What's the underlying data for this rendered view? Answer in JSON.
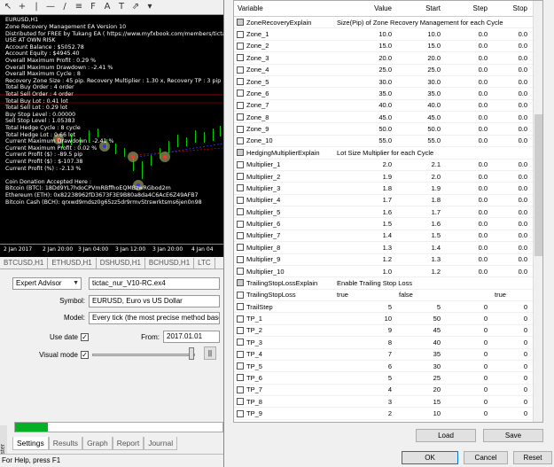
{
  "chart": {
    "window_title": "EURUSD,H1",
    "info_lines": [
      "Zone Recovery Management EA Version 10",
      "Distributed for FREE by Tukang EA ( https://www.myfxbook.com/members/tictac_nur )",
      "USE AT OWN RISK",
      "Account Balance : $5052.78",
      "Account Equity : $4945.40",
      "Overall Maximum Profit : 0.29 %",
      "Overall Maximum Drawdown : -2.41 %",
      "Overall Maximum Cycle : 8",
      "Recovery Zone Size : 45 pip. Recovery Multiplier : 1.30 x, Recovery TP : 3 pip",
      "Total Buy Order : 4 order",
      "Total Sell Order : 4 order",
      "Total Buy Lot : 0.41 lot",
      "Total Sell Lot : 0.29 lot",
      "Buy Stop Level : 0.00000",
      "Sell Stop Level : 1.05383",
      "Total Hedge Cycle : 8 cycle",
      "Total Hedge Lot : 0.66 lot",
      "Current Maximum Drawdown : -2.41 %",
      "Current Maximum Profit : 0.02 %",
      "Current Profit ($) : -89.5 pip",
      "Current Profit ($) : $-107.38",
      "Current Profit (%) : -2.13 %",
      "",
      "Coin Donation Accepted Here :",
      "Bitcoin (BTC): 18Dd9YL7hdoCPVmRBffhoEQMBzwRGbod2m",
      "Ethereum (ETH): 0x82238962fD3673F3E9B80a8da4C6AcE6Z49AFB7",
      "Bitcoin Cash (BCH): qrxwd9mdsz0g65zz5dr9rmvStrswrktsms6jen0n98"
    ],
    "time_ticks": [
      "2 Jan 2017",
      "2 Jan 20:00",
      "3 Jan 04:00",
      "3 Jan 12:00",
      "3 Jan 20:00",
      "4 Jan 04"
    ],
    "symbol_tabs": [
      "BTCUSD,H1",
      "ETHUSD,H1",
      "DSHUSD,H1",
      "BCHUSD,H1",
      "LTC"
    ]
  },
  "tester": {
    "type_value": "Expert Advisor",
    "ea_value": "tictac_nur_V10-RC.ex4",
    "symbol_label": "Symbol:",
    "symbol_value": "EURUSD, Euro vs US Dollar",
    "model_label": "Model:",
    "model_value": "Every tick (the most precise method based on a",
    "use_date_label": "Use date",
    "from_label": "From:",
    "from_value": "2017.01.01",
    "visual_label": "Visual mode",
    "pause_label": "||",
    "progress": 0.16,
    "side_label": "Tester",
    "tabs": [
      "Settings",
      "Results",
      "Graph",
      "Report",
      "Journal"
    ],
    "status": "For Help, press F1"
  },
  "dialog": {
    "headers": [
      "Variable",
      "Value",
      "Start",
      "Step",
      "Stop"
    ],
    "rows": [
      {
        "name": "ZoneRecoveryExplain",
        "wide": "Size(Pip) of Zone Recovery Management for each Cycle",
        "header": true
      },
      {
        "name": "Zone_1",
        "value": "10.0",
        "start": "10.0",
        "step": "0.0",
        "stop": "0.0"
      },
      {
        "name": "Zone_2",
        "value": "15.0",
        "start": "15.0",
        "step": "0.0",
        "stop": "0.0"
      },
      {
        "name": "Zone_3",
        "value": "20.0",
        "start": "20.0",
        "step": "0.0",
        "stop": "0.0"
      },
      {
        "name": "Zone_4",
        "value": "25.0",
        "start": "25.0",
        "step": "0.0",
        "stop": "0.0"
      },
      {
        "name": "Zone_5",
        "value": "30.0",
        "start": "30.0",
        "step": "0.0",
        "stop": "0.0"
      },
      {
        "name": "Zone_6",
        "value": "35.0",
        "start": "35.0",
        "step": "0.0",
        "stop": "0.0"
      },
      {
        "name": "Zone_7",
        "value": "40.0",
        "start": "40.0",
        "step": "0.0",
        "stop": "0.0"
      },
      {
        "name": "Zone_8",
        "value": "45.0",
        "start": "45.0",
        "step": "0.0",
        "stop": "0.0"
      },
      {
        "name": "Zone_9",
        "value": "50.0",
        "start": "50.0",
        "step": "0.0",
        "stop": "0.0"
      },
      {
        "name": "Zone_10",
        "value": "55.0",
        "start": "55.0",
        "step": "0.0",
        "stop": "0.0"
      },
      {
        "name": "HedgingMultiplierExplain",
        "wide": "Lot Size Multiplier for each Cycle",
        "header": true
      },
      {
        "name": "Multiplier_1",
        "value": "2.0",
        "start": "2.1",
        "step": "0.0",
        "stop": "0.0"
      },
      {
        "name": "Multiplier_2",
        "value": "1.9",
        "start": "2.0",
        "step": "0.0",
        "stop": "0.0"
      },
      {
        "name": "Multiplier_3",
        "value": "1.8",
        "start": "1.9",
        "step": "0.0",
        "stop": "0.0"
      },
      {
        "name": "Multiplier_4",
        "value": "1.7",
        "start": "1.8",
        "step": "0.0",
        "stop": "0.0"
      },
      {
        "name": "Multiplier_5",
        "value": "1.6",
        "start": "1.7",
        "step": "0.0",
        "stop": "0.0"
      },
      {
        "name": "Multiplier_6",
        "value": "1.5",
        "start": "1.6",
        "step": "0.0",
        "stop": "0.0"
      },
      {
        "name": "Multiplier_7",
        "value": "1.4",
        "start": "1.5",
        "step": "0.0",
        "stop": "0.0"
      },
      {
        "name": "Multiplier_8",
        "value": "1.3",
        "start": "1.4",
        "step": "0.0",
        "stop": "0.0"
      },
      {
        "name": "Multiplier_9",
        "value": "1.2",
        "start": "1.3",
        "step": "0.0",
        "stop": "0.0"
      },
      {
        "name": "Multiplier_10",
        "value": "1.0",
        "start": "1.2",
        "step": "0.0",
        "stop": "0.0"
      },
      {
        "name": "TrailingStopLossExplain",
        "wide": "Enable Trailing Stop Loss",
        "header": true
      },
      {
        "name": "TrailingStopLoss",
        "value": "true",
        "start": "false",
        "step": "",
        "stop": "true",
        "bool": true
      },
      {
        "name": "TrailStep",
        "value": "5",
        "start": "5",
        "step": "0",
        "stop": "0"
      },
      {
        "name": "TP_1",
        "value": "10",
        "start": "50",
        "step": "0",
        "stop": "0"
      },
      {
        "name": "TP_2",
        "value": "9",
        "start": "45",
        "step": "0",
        "stop": "0"
      },
      {
        "name": "TP_3",
        "value": "8",
        "start": "40",
        "step": "0",
        "stop": "0"
      },
      {
        "name": "TP_4",
        "value": "7",
        "start": "35",
        "step": "0",
        "stop": "0"
      },
      {
        "name": "TP_5",
        "value": "6",
        "start": "30",
        "step": "0",
        "stop": "0"
      },
      {
        "name": "TP_6",
        "value": "5",
        "start": "25",
        "step": "0",
        "stop": "0"
      },
      {
        "name": "TP_7",
        "value": "4",
        "start": "20",
        "step": "0",
        "stop": "0"
      },
      {
        "name": "TP_8",
        "value": "3",
        "start": "15",
        "step": "0",
        "stop": "0"
      },
      {
        "name": "TP_9",
        "value": "2",
        "start": "10",
        "step": "0",
        "stop": "0"
      },
      {
        "name": "TP_10",
        "value": "1",
        "start": "5",
        "step": "0",
        "stop": "0"
      }
    ],
    "load_label": "Load",
    "save_label": "Save",
    "ok_label": "OK",
    "cancel_label": "Cancel",
    "reset_label": "Reset"
  }
}
